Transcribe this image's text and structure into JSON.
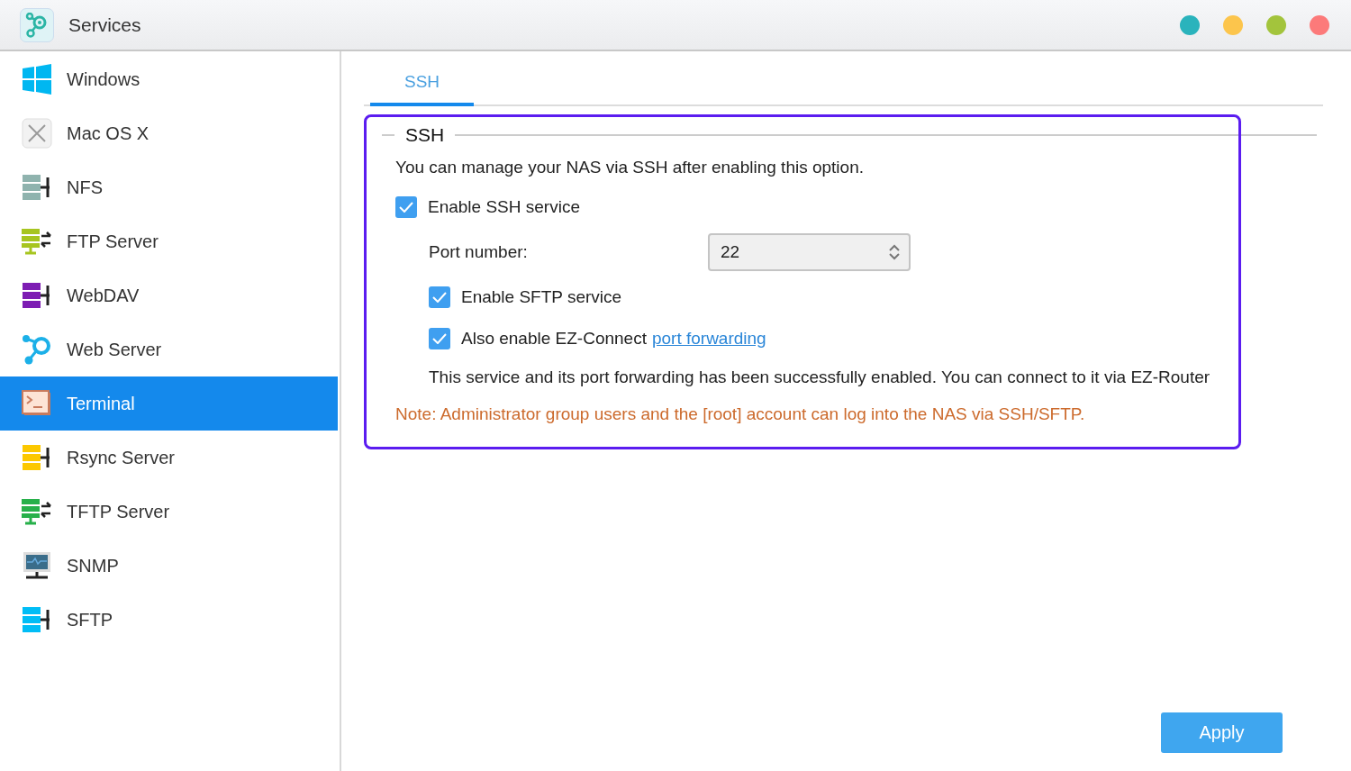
{
  "window": {
    "title": "Services",
    "controls": [
      {
        "color": "#2ab3bc"
      },
      {
        "color": "#fcc54c"
      },
      {
        "color": "#a3c43c"
      },
      {
        "color": "#fc7a7a"
      }
    ]
  },
  "sidebar": {
    "items": [
      {
        "label": "Windows",
        "kind": "windows",
        "color": "#00b7f1",
        "selected": false
      },
      {
        "label": "Mac OS X",
        "kind": "mac",
        "color": "#9a9a9a",
        "selected": false
      },
      {
        "label": "NFS",
        "kind": "server",
        "color": "#8fb3ae",
        "selected": false
      },
      {
        "label": "FTP Server",
        "kind": "transfer",
        "color": "#a7c520",
        "selected": false
      },
      {
        "label": "WebDAV",
        "kind": "server",
        "color": "#7d1db3",
        "selected": false
      },
      {
        "label": "Web Server",
        "kind": "web",
        "color": "#1cb0e8",
        "selected": false
      },
      {
        "label": "Terminal",
        "kind": "terminal",
        "color": "#c87b5e",
        "selected": true
      },
      {
        "label": "Rsync Server",
        "kind": "server",
        "color": "#fcc800",
        "selected": false
      },
      {
        "label": "TFTP Server",
        "kind": "transfer",
        "color": "#27b04a",
        "selected": false
      },
      {
        "label": "SNMP",
        "kind": "monitor",
        "color": "#3a6d8a",
        "selected": false
      },
      {
        "label": "SFTP",
        "kind": "server",
        "color": "#00bdf6",
        "selected": false
      }
    ]
  },
  "tabs": [
    {
      "label": "SSH",
      "selected": true
    }
  ],
  "section": {
    "title": "SSH",
    "description": "You can manage your NAS via SSH after enabling this option.",
    "enable_ssh": {
      "label": "Enable SSH service",
      "checked": true
    },
    "port": {
      "label": "Port number:",
      "value": "22"
    },
    "enable_sftp": {
      "label": "Enable SFTP service",
      "checked": true
    },
    "ez_connect": {
      "label": "Also enable EZ-Connect",
      "link": "port forwarding",
      "checked": true
    },
    "status": "This service and its port forwarding has been successfully enabled. You can connect to it via EZ-Router",
    "note": "Note: Administrator group users and the [root] account can log into the NAS via SSH/SFTP."
  },
  "buttons": {
    "apply": "Apply"
  }
}
